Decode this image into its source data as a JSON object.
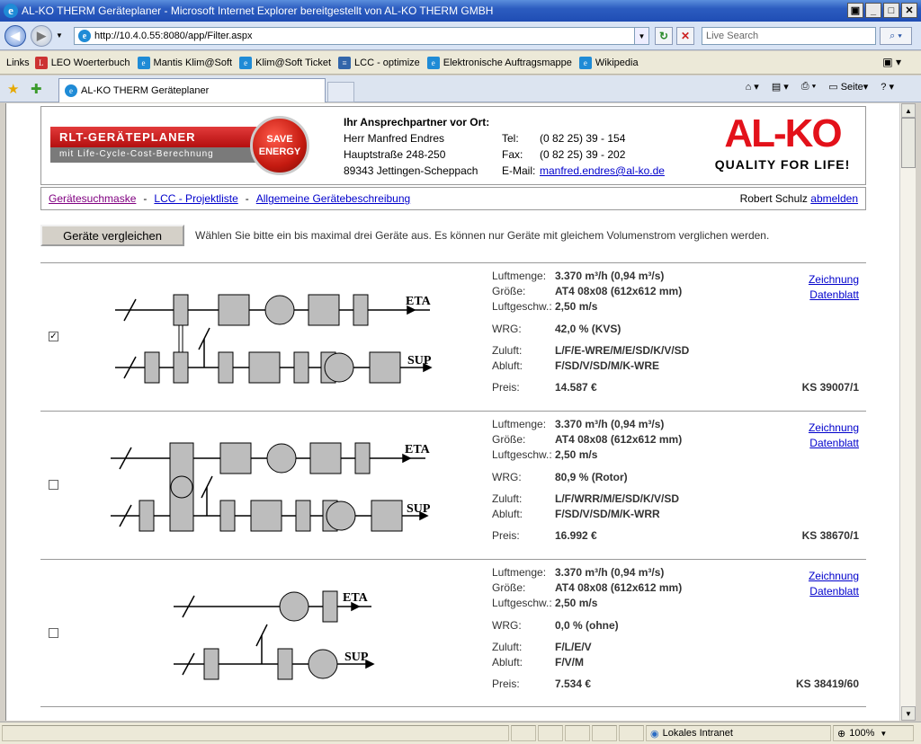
{
  "window": {
    "title": "AL-KO THERM Geräteplaner - Microsoft Internet Explorer bereitgestellt von AL-KO THERM GMBH"
  },
  "address": {
    "url": "http://10.4.0.55:8080/app/Filter.aspx",
    "search_placeholder": "Live Search"
  },
  "links_bar": {
    "label": "Links",
    "items": [
      "LEO Woerterbuch",
      "Mantis Klim@Soft",
      "Klim@Soft Ticket",
      "LCC - optimize",
      "Elektronische Auftragsmappe",
      "Wikipedia"
    ]
  },
  "tab": {
    "title": "AL-KO THERM Geräteplaner"
  },
  "commands": {
    "page": "Seite"
  },
  "status": {
    "zone": "Lokales Intranet",
    "zoom": "100%"
  },
  "header": {
    "banner_title": "RLT-GERÄTEPLANER",
    "banner_subtitle": "mit Life-Cycle-Cost-Berechnung",
    "seal_line1": "SAVE",
    "seal_line2": "ENERGY",
    "contact_heading": "Ihr Ansprechpartner vor Ort:",
    "contact_name": "Herr Manfred Endres",
    "contact_street": "Hauptstraße 248-250",
    "contact_city": "89343 Jettingen-Scheppach",
    "tel_label": "Tel:",
    "tel_value": "(0 82 25) 39 - 154",
    "fax_label": "Fax:",
    "fax_value": "(0 82 25) 39 - 202",
    "email_label": "E-Mail:",
    "email_value": "manfred.endres@al-ko.de",
    "logo_text": "AL-KO",
    "logo_claim": "QUALITY FOR LIFE!"
  },
  "menu": {
    "item1": "Gerätesuchmaske",
    "item2": "LCC - Projektliste",
    "item3": "Allgemeine Gerätebeschreibung",
    "separator": "-",
    "user": "Robert Schulz",
    "logout": "abmelden"
  },
  "compare": {
    "button": "Geräte vergleichen",
    "hint": "Wählen Sie bitte ein bis maximal drei Geräte aus. Es können nur Geräte mit gleichem Volumenstrom verglichen werden."
  },
  "labels": {
    "luftmenge": "Luftmenge:",
    "groesse": "Größe:",
    "luftgeschw": "Luftgeschw.:",
    "wrg": "WRG:",
    "zuluft": "Zuluft:",
    "abluft": "Abluft:",
    "preis": "Preis:",
    "zeichnung": "Zeichnung",
    "datenblatt": "Datenblatt",
    "eta": "ETA",
    "sup": "SUP"
  },
  "units": [
    {
      "checked": true,
      "luftmenge": "3.370 m³/h  (0,94 m³/s)",
      "groesse": "AT4 08x08 (612x612 mm)",
      "luftgeschw": "2,50 m/s",
      "wrg": "42,0 % (KVS)",
      "zuluft": "L/F/E-WRE/M/E/SD/K/V/SD",
      "abluft": "F/SD/V/SD/M/K-WRE",
      "preis": "14.587 €",
      "ks": "KS 39007/1"
    },
    {
      "checked": false,
      "luftmenge": "3.370 m³/h  (0,94 m³/s)",
      "groesse": "AT4 08x08 (612x612 mm)",
      "luftgeschw": "2,50 m/s",
      "wrg": "80,9 % (Rotor)",
      "zuluft": "L/F/WRR/M/E/SD/K/V/SD",
      "abluft": "F/SD/V/SD/M/K-WRR",
      "preis": "16.992 €",
      "ks": "KS 38670/1"
    },
    {
      "checked": false,
      "luftmenge": "3.370 m³/h  (0,94 m³/s)",
      "groesse": "AT4 08x08 (612x612 mm)",
      "luftgeschw": "2,50 m/s",
      "wrg": "0,0 % (ohne)",
      "zuluft": "F/L/E/V",
      "abluft": "F/V/M",
      "preis": "7.534 €",
      "ks": "KS 38419/60"
    }
  ]
}
